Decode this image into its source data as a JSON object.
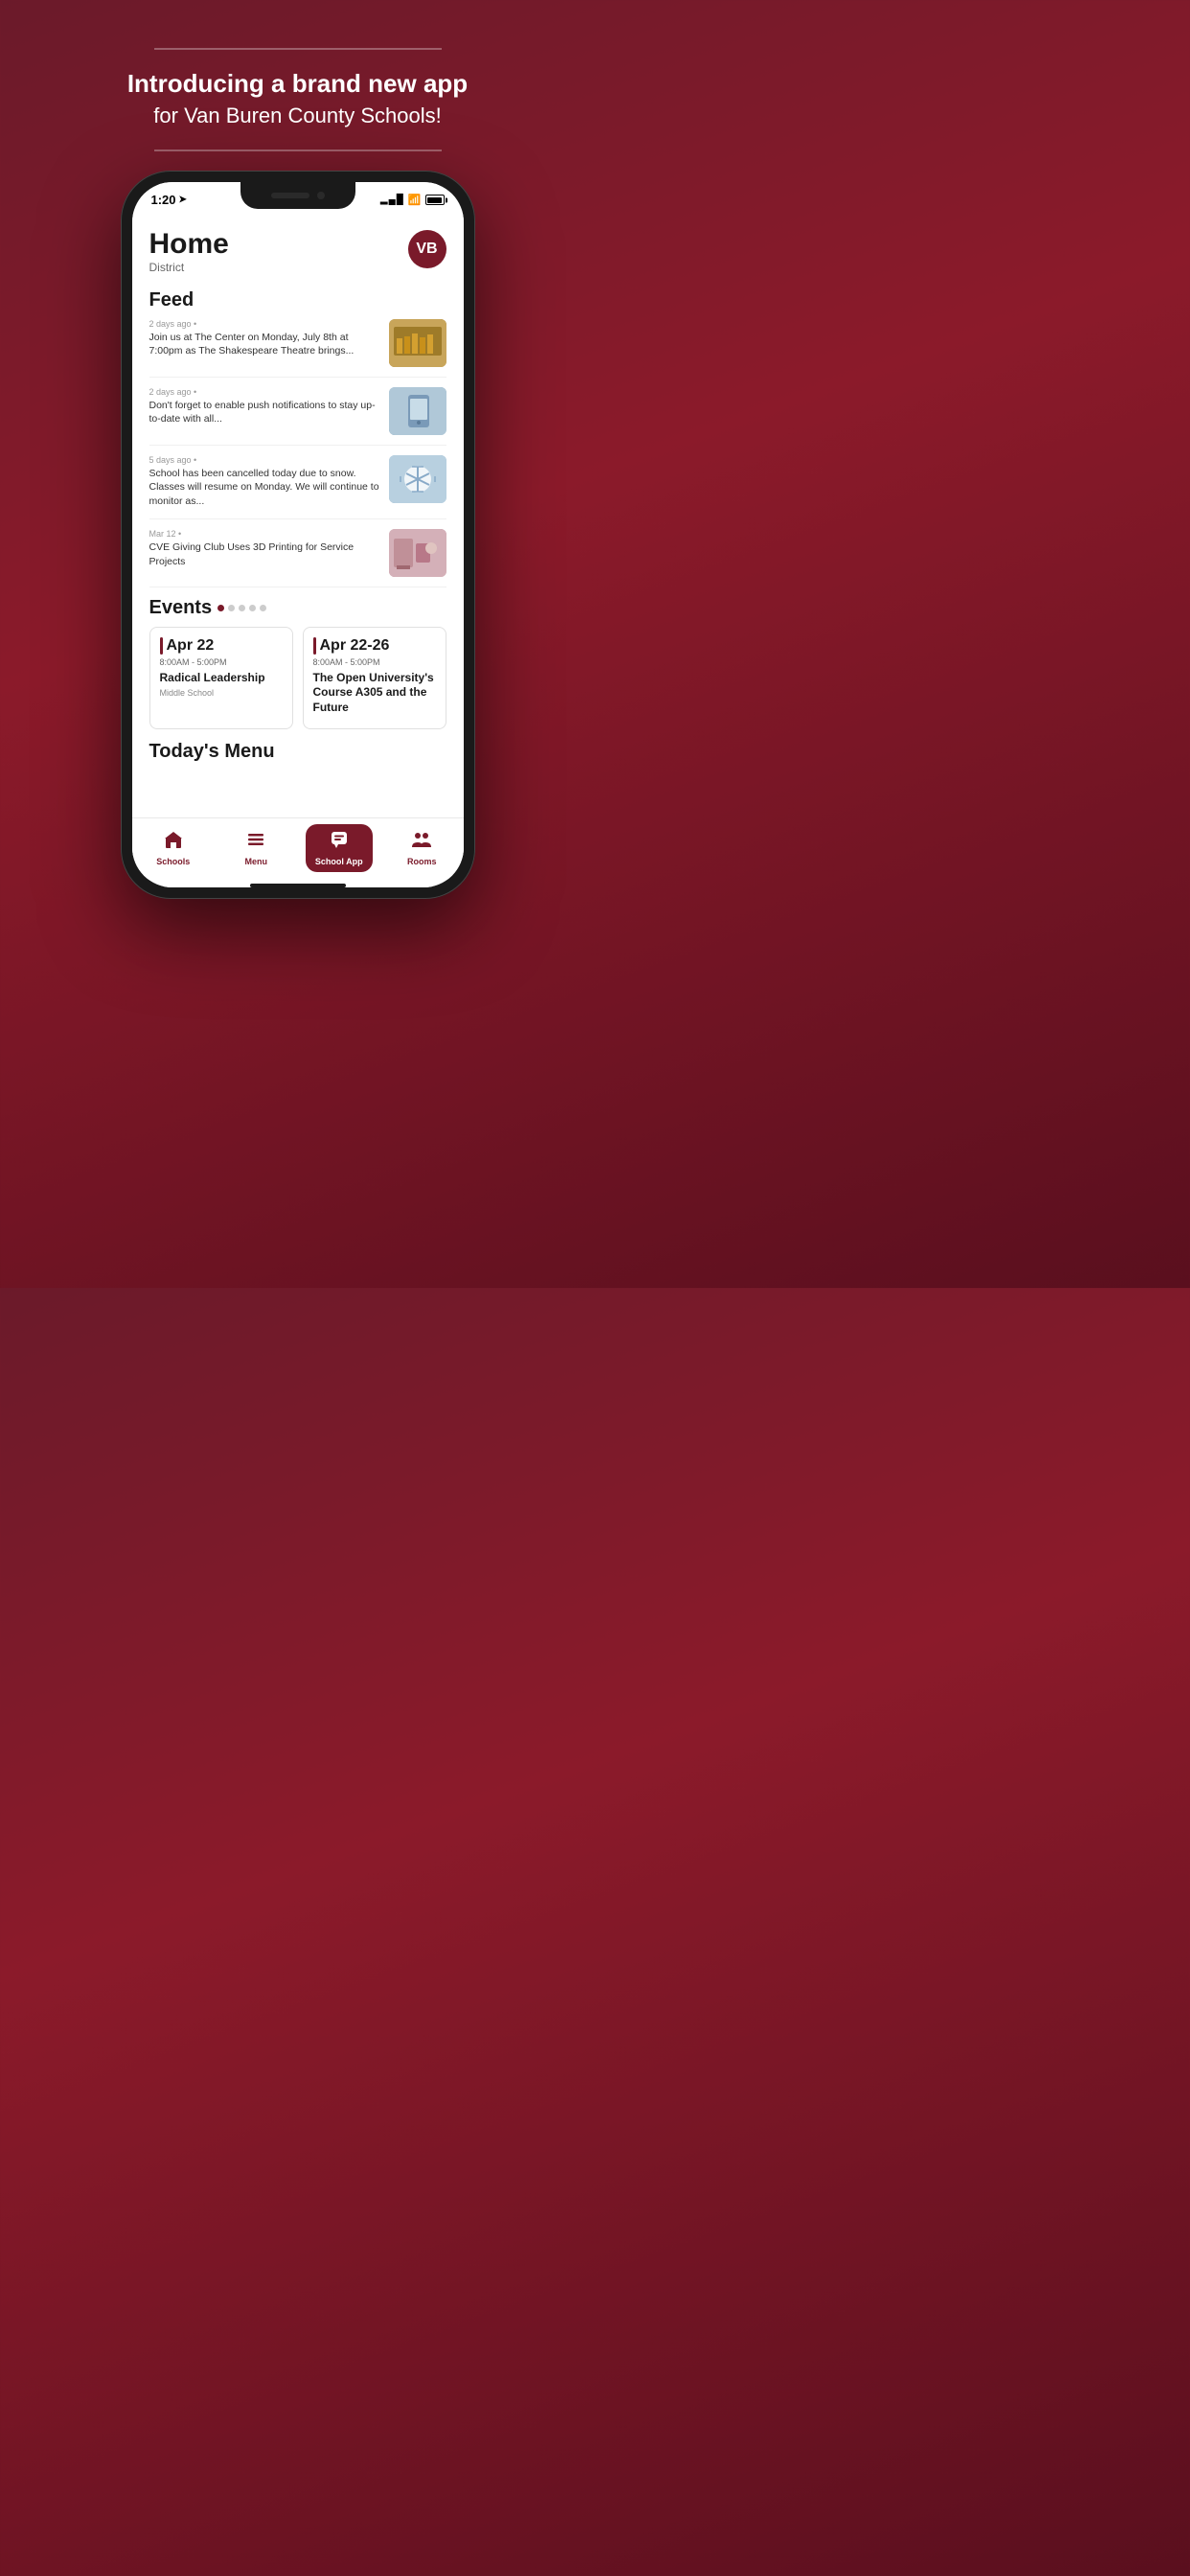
{
  "background": {
    "gradient_start": "#6b1a2a",
    "gradient_end": "#5a0f1e"
  },
  "hero": {
    "line1": "Introducing a brand new app",
    "line2": "for Van Buren County Schools!"
  },
  "status_bar": {
    "time": "1:20",
    "signal_bars": "▂▄▆",
    "wifi": "wifi",
    "battery": "battery"
  },
  "home": {
    "title": "Home",
    "subtitle": "District",
    "avatar_initials": "VB"
  },
  "feed": {
    "section_label": "Feed",
    "items": [
      {
        "meta": "2 days ago • ",
        "text": "Join us at The Center on Monday, July 8th at 7:00pm as The Shakespeare Theatre brings...",
        "thumb_type": "theater"
      },
      {
        "meta": "2 days ago • ",
        "text": "Don't forget to enable push notifications to stay up-to-date with all...",
        "thumb_type": "phone"
      },
      {
        "meta": "5 days ago • ",
        "text": "School has been cancelled today due to snow. Classes will resume on Monday. We will continue to monitor as...",
        "thumb_type": "snow"
      },
      {
        "meta": "Mar 12 • ",
        "text": "CVE Giving Club Uses 3D Printing for Service Projects",
        "thumb_type": "art"
      }
    ]
  },
  "events": {
    "section_label": "Events",
    "dots": [
      true,
      false,
      false,
      false,
      false
    ],
    "items": [
      {
        "date": "Apr 22",
        "time": "8:00AM  -  5:00PM",
        "name": "Radical Leadership",
        "location": "Middle School"
      },
      {
        "date": "Apr 22-26",
        "time": "8:00AM  -  5:00PM",
        "name": "The Open University's Course A305 and the Future",
        "location": ""
      }
    ]
  },
  "todays_menu": {
    "section_label": "Today's Menu"
  },
  "bottom_nav": {
    "items": [
      {
        "label": "Schools",
        "icon": "building",
        "active": false
      },
      {
        "label": "Menu",
        "icon": "menu",
        "active": false
      },
      {
        "label": "School App",
        "icon": "chat",
        "active": true
      },
      {
        "label": "Rooms",
        "icon": "people",
        "active": false
      }
    ]
  }
}
